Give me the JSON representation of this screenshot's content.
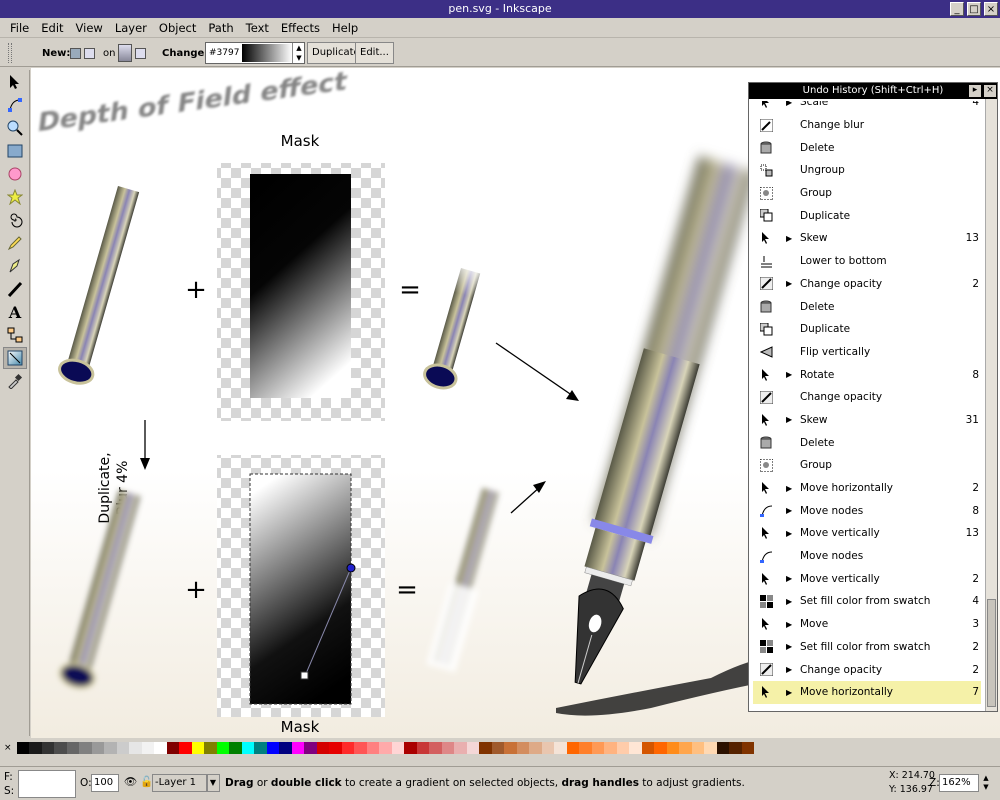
{
  "window": {
    "title": "pen.svg - Inkscape"
  },
  "menu": [
    "File",
    "Edit",
    "View",
    "Layer",
    "Object",
    "Path",
    "Text",
    "Effects",
    "Help"
  ],
  "toolctrl": {
    "new_label": "New:",
    "on_label": "on",
    "change_label": "Change:",
    "gradient_id": "#3797",
    "duplicate_label": "Duplicate",
    "edit_label": "Edit..."
  },
  "canvas": {
    "dof_title": "Depth of Field effect",
    "mask_top": "Mask",
    "mask_bottom": "Mask",
    "plus1": "+",
    "plus2": "+",
    "eq1": "=",
    "eq2": "=",
    "dup_line1": "Duplicate,",
    "dup_line2": "Blur 4%"
  },
  "undo": {
    "title": "Undo History (Shift+Ctrl+H)",
    "items": [
      {
        "icon": "arrow-icon",
        "label": "Scale",
        "count": "4",
        "expand": true,
        "partial": true
      },
      {
        "icon": "pencil-blur-icon",
        "label": "Change blur",
        "count": "",
        "expand": false
      },
      {
        "icon": "trash-icon",
        "label": "Delete",
        "count": "",
        "expand": false
      },
      {
        "icon": "ungroup-icon",
        "label": "Ungroup",
        "count": "",
        "expand": false
      },
      {
        "icon": "group-icon",
        "label": "Group",
        "count": "",
        "expand": false
      },
      {
        "icon": "duplicate-icon",
        "label": "Duplicate",
        "count": "",
        "expand": false
      },
      {
        "icon": "arrow-icon",
        "label": "Skew",
        "count": "13",
        "expand": true
      },
      {
        "icon": "lower-icon",
        "label": "Lower to bottom",
        "count": "",
        "expand": false
      },
      {
        "icon": "opacity-icon",
        "label": "Change opacity",
        "count": "2",
        "expand": true
      },
      {
        "icon": "trash-icon",
        "label": "Delete",
        "count": "",
        "expand": false
      },
      {
        "icon": "duplicate-icon",
        "label": "Duplicate",
        "count": "",
        "expand": false
      },
      {
        "icon": "flip-icon",
        "label": "Flip vertically",
        "count": "",
        "expand": false
      },
      {
        "icon": "arrow-icon",
        "label": "Rotate",
        "count": "8",
        "expand": true
      },
      {
        "icon": "opacity-icon",
        "label": "Change opacity",
        "count": "",
        "expand": false
      },
      {
        "icon": "arrow-icon",
        "label": "Skew",
        "count": "31",
        "expand": true
      },
      {
        "icon": "trash-icon",
        "label": "Delete",
        "count": "",
        "expand": false
      },
      {
        "icon": "group-icon",
        "label": "Group",
        "count": "",
        "expand": false
      },
      {
        "icon": "arrow-icon",
        "label": "Move horizontally",
        "count": "2",
        "expand": true
      },
      {
        "icon": "nodes-icon",
        "label": "Move nodes",
        "count": "8",
        "expand": true
      },
      {
        "icon": "arrow-icon",
        "label": "Move vertically",
        "count": "13",
        "expand": true
      },
      {
        "icon": "nodes-icon",
        "label": "Move nodes",
        "count": "",
        "expand": false
      },
      {
        "icon": "arrow-icon",
        "label": "Move vertically",
        "count": "2",
        "expand": true
      },
      {
        "icon": "swatch-icon",
        "label": "Set fill color from swatch",
        "count": "4",
        "expand": true
      },
      {
        "icon": "arrow-icon",
        "label": "Move",
        "count": "3",
        "expand": true
      },
      {
        "icon": "swatch-icon",
        "label": "Set fill color from swatch",
        "count": "2",
        "expand": true
      },
      {
        "icon": "opacity-icon",
        "label": "Change opacity",
        "count": "2",
        "expand": true
      },
      {
        "icon": "arrow-icon",
        "label": "Move horizontally",
        "count": "7",
        "expand": true,
        "selected": true
      }
    ]
  },
  "palette": [
    "#000000",
    "#1a1a1a",
    "#333333",
    "#4d4d4d",
    "#666666",
    "#808080",
    "#999999",
    "#b3b3b3",
    "#cccccc",
    "#e6e6e6",
    "#f2f2f2",
    "#ffffff",
    "#800000",
    "#ff0000",
    "#ffff00",
    "#808000",
    "#00ff00",
    "#008000",
    "#00ffff",
    "#008080",
    "#0000ff",
    "#000080",
    "#ff00ff",
    "#800080",
    "#d40000",
    "#e60000",
    "#ff2a2a",
    "#ff5555",
    "#ff8080",
    "#ffaaaa",
    "#ffd5d5",
    "#aa0000",
    "#c83737",
    "#d35f5f",
    "#de8787",
    "#e9afaf",
    "#f4d7d7",
    "#803300",
    "#a05a2c",
    "#c87137",
    "#d38d5f",
    "#deaa87",
    "#e9c6af",
    "#f4e3d7",
    "#ff6600",
    "#ff7f2a",
    "#ff9955",
    "#ffb380",
    "#ffccaa",
    "#ffe6d5",
    "#d45500",
    "#ff6600",
    "#ff8c1a",
    "#ffa64d",
    "#ffbf80",
    "#ffd9b3",
    "#2b1100",
    "#552200",
    "#803300"
  ],
  "status": {
    "fill_label": "F:",
    "stroke_label": "S:",
    "opacity_label": "O:",
    "opacity_value": "100",
    "layer": "-Layer 1",
    "msg_b1": "Drag",
    "msg_t1": " or ",
    "msg_b2": "double click",
    "msg_t2": " to create a gradient on selected objects, ",
    "msg_b3": "drag handles",
    "msg_t3": " to adjust gradients.",
    "x_coord": "X: 214.70",
    "y_coord": "Y: 136.97",
    "zoom_label": "Z:",
    "zoom": "162%"
  }
}
